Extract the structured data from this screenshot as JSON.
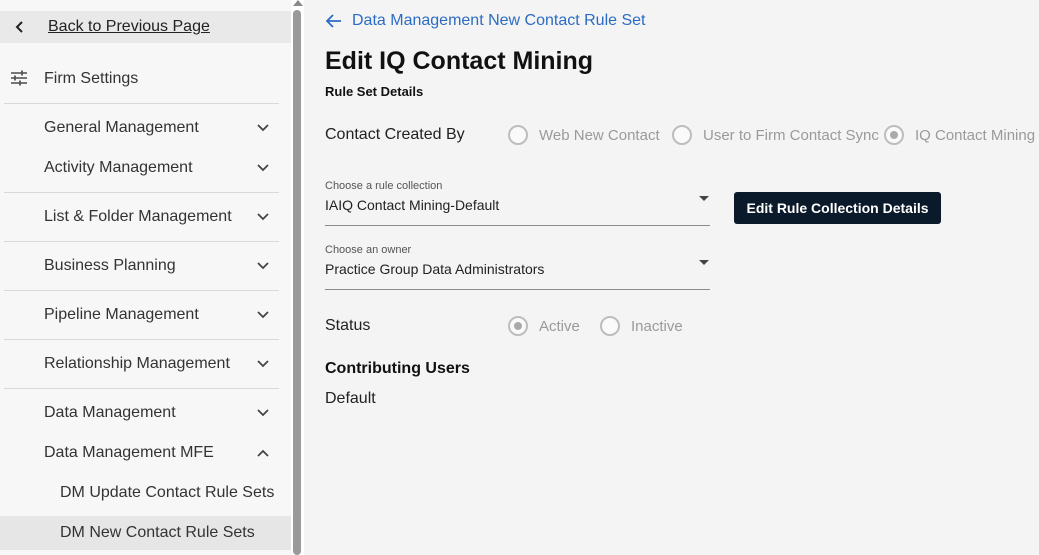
{
  "sidebar": {
    "back_label": "Back to Previous Page",
    "firm_settings": "Firm Settings",
    "items": [
      {
        "label": "General Management"
      },
      {
        "label": "Activity Management"
      },
      {
        "label": "List & Folder Management"
      },
      {
        "label": "Business Planning"
      },
      {
        "label": "Pipeline Management"
      },
      {
        "label": "Relationship Management"
      },
      {
        "label": "Data Management"
      },
      {
        "label": "Data Management MFE"
      }
    ],
    "subitems": [
      {
        "label": "DM Update Contact Rule Sets"
      },
      {
        "label": "DM New Contact Rule Sets"
      }
    ]
  },
  "main": {
    "breadcrumb": "Data Management New Contact Rule Set",
    "title": "Edit IQ Contact Mining",
    "section": "Rule Set Details",
    "contact_created_by": {
      "label": "Contact Created By",
      "options": [
        "Web New Contact",
        "User to Firm Contact Sync",
        "IQ Contact Mining"
      ],
      "selected": "IQ Contact Mining"
    },
    "rule_collection": {
      "label": "Choose a rule collection",
      "value": "IAIQ Contact Mining-Default"
    },
    "edit_button": "Edit Rule Collection Details",
    "owner": {
      "label": "Choose an owner",
      "value": "Practice Group Data Administrators"
    },
    "status": {
      "label": "Status",
      "options": [
        "Active",
        "Inactive"
      ],
      "selected": "Active"
    },
    "contributing_users": {
      "title": "Contributing Users",
      "value": "Default"
    }
  }
}
